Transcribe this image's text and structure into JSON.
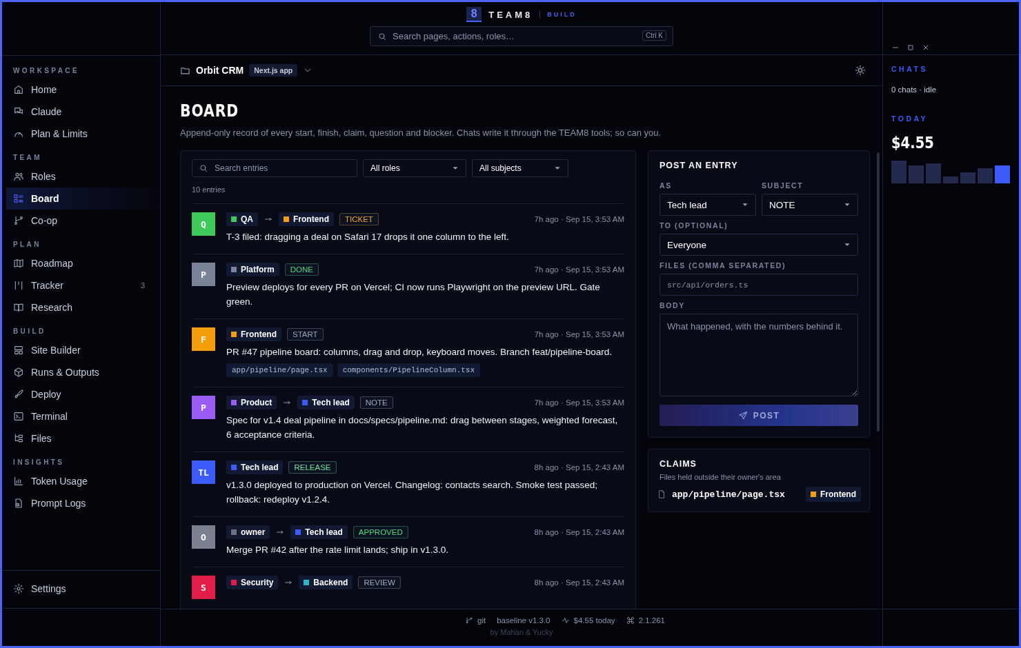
{
  "topbar": {
    "logo_mark": "8",
    "brand": "TEAM8",
    "mode": "BUILD",
    "search": {
      "placeholder": "Search pages, actions, roles…",
      "shortcut": "Ctrl K"
    }
  },
  "sidebar": {
    "sections": [
      {
        "title": "WORKSPACE",
        "items": [
          {
            "label": "Home",
            "selected": false
          },
          {
            "label": "Claude",
            "selected": false
          },
          {
            "label": "Plan & Limits",
            "selected": false
          }
        ]
      },
      {
        "title": "TEAM",
        "items": [
          {
            "label": "Roles",
            "selected": false
          },
          {
            "label": "Board",
            "selected": true
          },
          {
            "label": "Co-op",
            "selected": false
          }
        ]
      },
      {
        "title": "PLAN",
        "items": [
          {
            "label": "Roadmap",
            "selected": false
          },
          {
            "label": "Tracker",
            "selected": false,
            "count": "3"
          },
          {
            "label": "Research",
            "selected": false
          }
        ]
      },
      {
        "title": "BUILD",
        "items": [
          {
            "label": "Site Builder",
            "selected": false
          },
          {
            "label": "Runs & Outputs",
            "selected": false
          },
          {
            "label": "Deploy",
            "selected": false
          },
          {
            "label": "Terminal",
            "selected": false
          },
          {
            "label": "Files",
            "selected": false
          }
        ]
      },
      {
        "title": "INSIGHTS",
        "items": [
          {
            "label": "Token Usage",
            "selected": false
          },
          {
            "label": "Prompt Logs",
            "selected": false
          }
        ]
      }
    ],
    "footer_item": {
      "label": "Settings"
    }
  },
  "project": {
    "name": "Orbit CRM",
    "badge": "Next.js app"
  },
  "page": {
    "title": "BOARD",
    "description": "Append-only record of every start, finish, claim, question and blocker. Chats write it through the TEAM8 tools; so can you."
  },
  "board": {
    "search": {
      "placeholder": "Search entries"
    },
    "filters": [
      "All roles",
      "All subjects"
    ],
    "count": "10 entries",
    "entries": [
      {
        "avatar": "Q",
        "color": "#3fc95a",
        "from": {
          "role": "QA",
          "color": "#3fc95a"
        },
        "to": {
          "role": "Frontend",
          "color": "#f59e0b"
        },
        "tag": {
          "label": "TICKET",
          "color": "#f5a524"
        },
        "time": "7h ago · Sep 15, 3:53 AM",
        "body": "T-3 filed: dragging a deal on Safari 17 drops it one column to the left."
      },
      {
        "avatar": "P",
        "color": "#7a8398",
        "from": {
          "role": "Platform",
          "color": "#7a8398"
        },
        "tag": {
          "label": "DONE",
          "color": "#4ade80"
        },
        "time": "7h ago · Sep 15, 3:53 AM",
        "body": "Preview deploys for every PR on Vercel; CI now runs Playwright on the preview URL. Gate green."
      },
      {
        "avatar": "F",
        "color": "#f59e0b",
        "from": {
          "role": "Frontend",
          "color": "#f59e0b"
        },
        "tag": {
          "label": "START",
          "color": "#9aa3b5"
        },
        "time": "7h ago · Sep 15, 3:53 AM",
        "body": "PR #47 pipeline board: columns, drag and drop, keyboard moves. Branch feat/pipeline-board.",
        "files": [
          "app/pipeline/page.tsx",
          "components/PipelineColumn.tsx"
        ]
      },
      {
        "avatar": "P",
        "color": "#9b5cf6",
        "from": {
          "role": "Product",
          "color": "#9b5cf6"
        },
        "to": {
          "role": "Tech lead",
          "color": "#3b5bfd"
        },
        "tag": {
          "label": "NOTE",
          "color": "#9aa9c9"
        },
        "time": "7h ago · Sep 15, 3:53 AM",
        "body": "Spec for v1.4 deal pipeline in docs/specs/pipeline.md: drag between stages, weighted forecast, 6 acceptance criteria."
      },
      {
        "avatar": "TL",
        "color": "#3b5bfd",
        "from": {
          "role": "Tech lead",
          "color": "#3b5bfd"
        },
        "tag": {
          "label": "RELEASE",
          "color": "#6ee7a0"
        },
        "time": "8h ago · Sep 15, 2:43 AM",
        "body": "v1.3.0 deployed to production on Vercel. Changelog: contacts search. Smoke test passed; rollback: redeploy v1.2.4."
      },
      {
        "avatar": "O",
        "color": "#7b8190",
        "from": {
          "role": "owner",
          "color": "#6b7280"
        },
        "to": {
          "role": "Tech lead",
          "color": "#3b5bfd"
        },
        "tag": {
          "label": "APPROVED",
          "color": "#4ade80"
        },
        "time": "8h ago · Sep 15, 2:43 AM",
        "body": "Merge PR #42 after the rate limit lands; ship in v1.3.0."
      },
      {
        "avatar": "S",
        "color": "#e11d48",
        "from": {
          "role": "Security",
          "color": "#e11d48"
        },
        "to": {
          "role": "Backend",
          "color": "#2bb5c8"
        },
        "tag": {
          "label": "REVIEW",
          "color": "#a3aabb"
        },
        "time": "8h ago · Sep 15, 2:43 AM"
      }
    ]
  },
  "post_form": {
    "title": "POST AN ENTRY",
    "as": {
      "label": "AS",
      "value": "Tech lead"
    },
    "subject": {
      "label": "SUBJECT",
      "value": "NOTE"
    },
    "to": {
      "label": "TO (OPTIONAL)",
      "value": "Everyone"
    },
    "files": {
      "label": "FILES (COMMA SEPARATED)",
      "placeholder": "src/api/orders.ts"
    },
    "body": {
      "label": "BODY",
      "placeholder": "What happened, with the numbers behind it."
    },
    "button": "POST"
  },
  "claims": {
    "title": "CLAIMS",
    "subtitle": "Files held outside their owner's area",
    "items": [
      {
        "file": "app/pipeline/page.tsx",
        "role": "Frontend",
        "color": "#f59e0b"
      }
    ]
  },
  "rail": {
    "chats_title": "CHATS",
    "chats_status": "0 chats · idle",
    "today_title": "TODAY",
    "today_amount": "$4.55"
  },
  "status_bar": {
    "items": [
      "git",
      "baseline v1.3.0",
      "$4.55 today",
      "2.1.261"
    ],
    "credit": "by Mahan & Yucky"
  }
}
